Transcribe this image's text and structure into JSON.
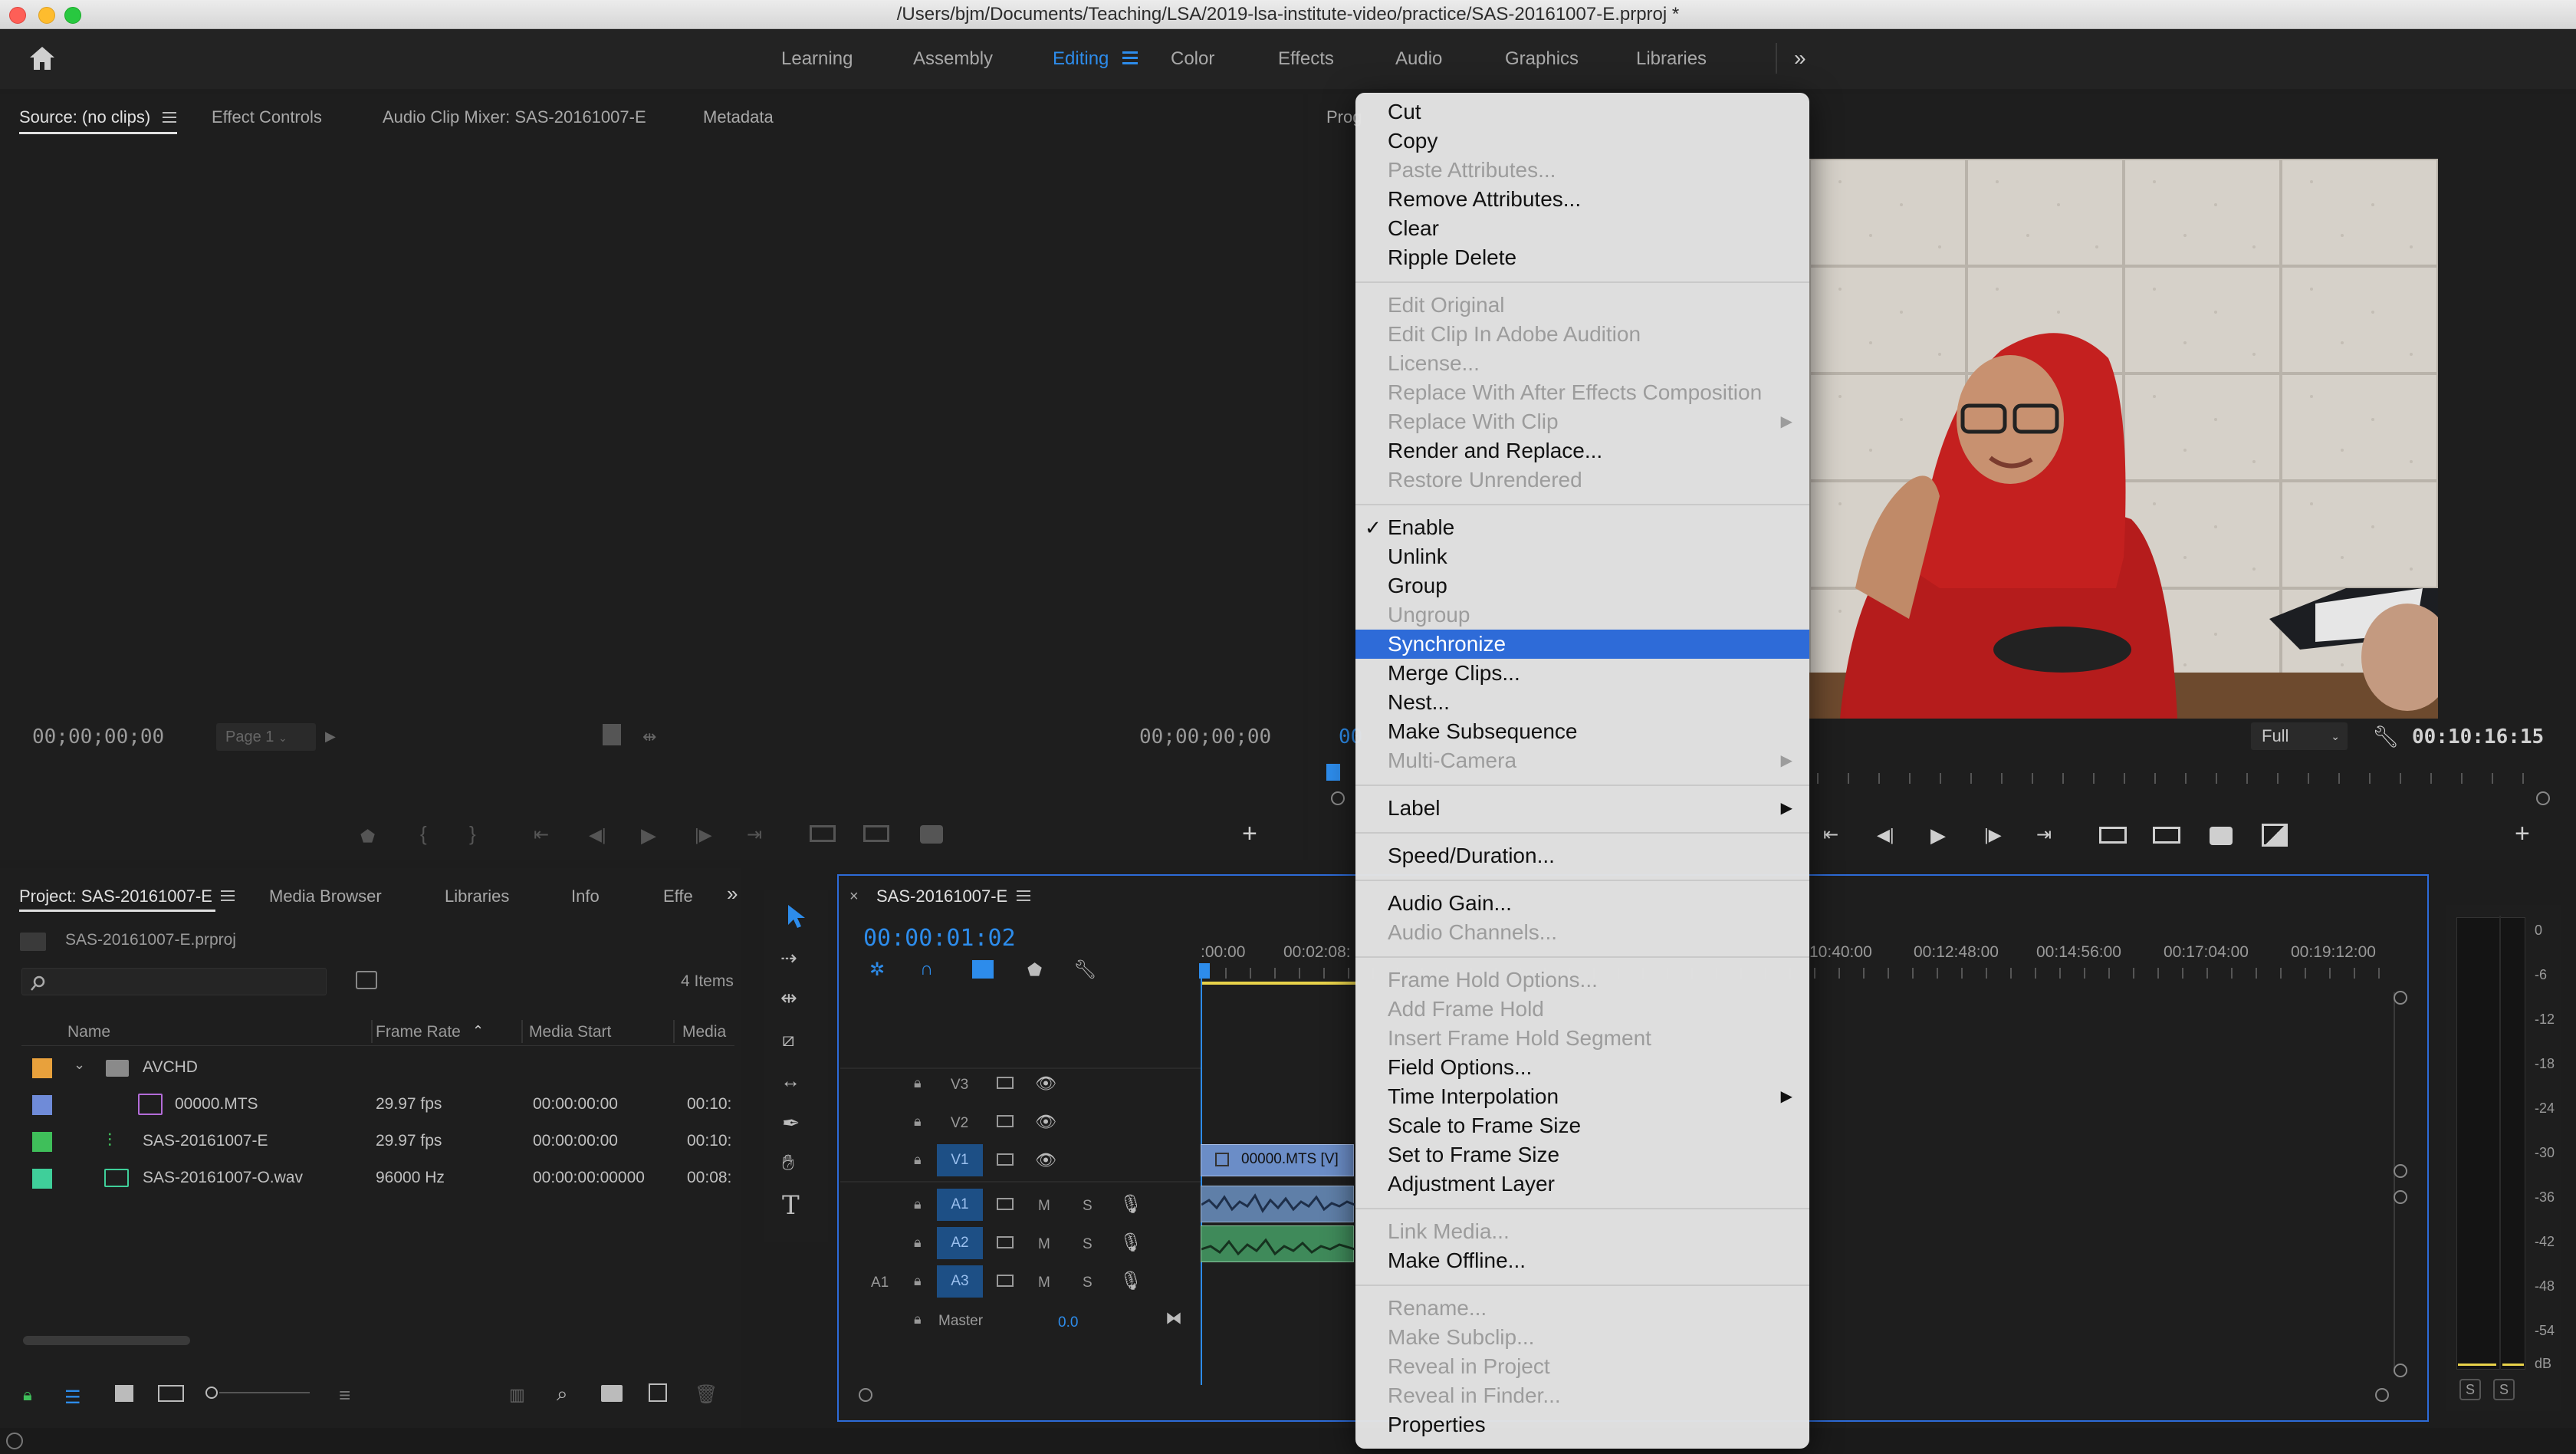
{
  "window": {
    "title": "/Users/bjm/Documents/Teaching/LSA/2019-lsa-institute-video/practice/SAS-20161007-E.prproj *"
  },
  "workspaces": {
    "tabs": [
      {
        "label": "Learning"
      },
      {
        "label": "Assembly"
      },
      {
        "label": "Editing"
      },
      {
        "label": "Color"
      },
      {
        "label": "Effects"
      },
      {
        "label": "Audio"
      },
      {
        "label": "Graphics"
      },
      {
        "label": "Libraries"
      }
    ],
    "active": "Editing",
    "accent": "#2d8ceb"
  },
  "source_panel": {
    "tabs": [
      "Source: (no clips)",
      "Effect Controls",
      "Audio Clip Mixer: SAS-20161007-E",
      "Metadata"
    ],
    "timecode_left": "00;00;00;00",
    "timecode_right": "00;00;00;00",
    "page": "Page 1"
  },
  "program_panel": {
    "tab_partial": "Prog",
    "timecode_left_partial": "00",
    "fit": "Full",
    "timecode_right": "00:10:16:15"
  },
  "project_panel": {
    "tabs": [
      "Project: SAS-20161007-E",
      "Media Browser",
      "Libraries",
      "Info",
      "Effe"
    ],
    "file": "SAS-20161007-E.prproj",
    "items_count": "4 Items",
    "columns": [
      "Name",
      "Frame Rate",
      "Media Start",
      "Media"
    ],
    "rows": [
      {
        "color": "#e8a13c",
        "name": "AVCHD",
        "rate": "",
        "start": "",
        "media": "",
        "type": "folder"
      },
      {
        "color": "#6f8bd8",
        "name": "00000.MTS",
        "rate": "29.97 fps",
        "start": "00:00:00:00",
        "media": "00:10:",
        "type": "clip"
      },
      {
        "color": "#3fbf5a",
        "name": "SAS-20161007-E",
        "rate": "29.97 fps",
        "start": "00:00:00:00",
        "media": "00:10:",
        "type": "sequence"
      },
      {
        "color": "#3fcf9a",
        "name": "SAS-20161007-O.wav",
        "rate": "96000 Hz",
        "start": "00:00:00:00000",
        "media": "00:08:",
        "type": "audio"
      }
    ]
  },
  "timeline": {
    "tab": "SAS-20161007-E",
    "timecode": "00:00:01:02",
    "ruler": [
      ":00:00",
      "00:02:08:",
      "10:40:00",
      "00:12:48:00",
      "00:14:56:00",
      "00:17:04:00",
      "00:19:12:00"
    ],
    "video_tracks": [
      "V3",
      "V2",
      "V1"
    ],
    "audio_tracks": [
      "A1",
      "A2",
      "A3"
    ],
    "source_patch": "A1",
    "master_label": "Master",
    "master_value": "0.0",
    "clip_v1": "00000.MTS [V]",
    "m": "M",
    "s": "S"
  },
  "meter": {
    "scale": [
      "0",
      "-6",
      "-12",
      "-18",
      "-24",
      "-30",
      "-36",
      "-42",
      "-48",
      "-54",
      "dB"
    ],
    "solo_left": "S",
    "solo_right": "S"
  },
  "context_menu": {
    "items": [
      {
        "label": "Cut",
        "state": "enabled"
      },
      {
        "label": "Copy",
        "state": "enabled"
      },
      {
        "label": "Paste Attributes...",
        "state": "disabled"
      },
      {
        "label": "Remove Attributes...",
        "state": "enabled"
      },
      {
        "label": "Clear",
        "state": "enabled"
      },
      {
        "label": "Ripple Delete",
        "state": "enabled"
      },
      {
        "sep": true
      },
      {
        "label": "Edit Original",
        "state": "disabled"
      },
      {
        "label": "Edit Clip In Adobe Audition",
        "state": "disabled"
      },
      {
        "label": "License...",
        "state": "disabled"
      },
      {
        "label": "Replace With After Effects Composition",
        "state": "disabled"
      },
      {
        "label": "Replace With Clip",
        "state": "disabled",
        "submenu": true
      },
      {
        "label": "Render and Replace...",
        "state": "enabled"
      },
      {
        "label": "Restore Unrendered",
        "state": "disabled"
      },
      {
        "sep": true
      },
      {
        "label": "Enable",
        "state": "enabled",
        "checked": true
      },
      {
        "label": "Unlink",
        "state": "enabled"
      },
      {
        "label": "Group",
        "state": "enabled"
      },
      {
        "label": "Ungroup",
        "state": "disabled"
      },
      {
        "label": "Synchronize",
        "state": "selected"
      },
      {
        "label": "Merge Clips...",
        "state": "enabled"
      },
      {
        "label": "Nest...",
        "state": "enabled"
      },
      {
        "label": "Make Subsequence",
        "state": "enabled"
      },
      {
        "label": "Multi-Camera",
        "state": "disabled",
        "submenu": true
      },
      {
        "sep": true
      },
      {
        "label": "Label",
        "state": "enabled",
        "submenu": true
      },
      {
        "sep": true
      },
      {
        "label": "Speed/Duration...",
        "state": "enabled"
      },
      {
        "sep": true
      },
      {
        "label": "Audio Gain...",
        "state": "enabled"
      },
      {
        "label": "Audio Channels...",
        "state": "disabled"
      },
      {
        "sep": true
      },
      {
        "label": "Frame Hold Options...",
        "state": "disabled"
      },
      {
        "label": "Add Frame Hold",
        "state": "disabled"
      },
      {
        "label": "Insert Frame Hold Segment",
        "state": "disabled"
      },
      {
        "label": "Field Options...",
        "state": "enabled"
      },
      {
        "label": "Time Interpolation",
        "state": "enabled",
        "submenu": true
      },
      {
        "label": "Scale to Frame Size",
        "state": "enabled"
      },
      {
        "label": "Set to Frame Size",
        "state": "enabled"
      },
      {
        "label": "Adjustment Layer",
        "state": "enabled"
      },
      {
        "sep": true
      },
      {
        "label": "Link Media...",
        "state": "disabled"
      },
      {
        "label": "Make Offline...",
        "state": "enabled"
      },
      {
        "sep": true
      },
      {
        "label": "Rename...",
        "state": "disabled"
      },
      {
        "label": "Make Subclip...",
        "state": "disabled"
      },
      {
        "label": "Reveal in Project",
        "state": "disabled"
      },
      {
        "label": "Reveal in Finder...",
        "state": "disabled"
      },
      {
        "label": "Properties",
        "state": "enabled"
      }
    ],
    "selection_color": "#2e6bd8"
  }
}
